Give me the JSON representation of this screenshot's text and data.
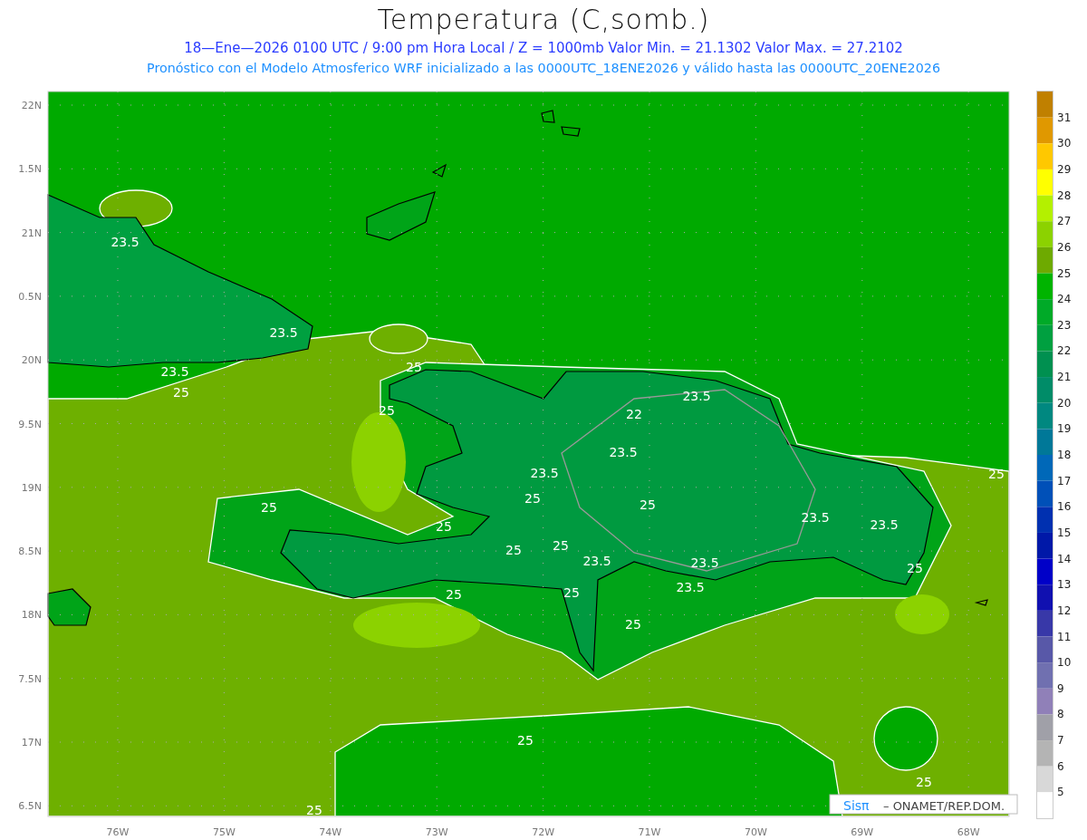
{
  "title": "Temperatura (C,somb.)",
  "subtitle": "18—Ene—2026  0100 UTC / 9:00 pm Hora Local / Z = 1000mb    Valor Min. = 21.1302  Valor Max. = 27.2102",
  "description": "Pronóstico con el Modelo Atmosferico WRF inicializado a las 0000UTC_18ENE2026 y válido hasta las  0000UTC_20ENE2026",
  "map": {
    "lat_labels": [
      "22N",
      "1.5N",
      "21N",
      "0.5N",
      "20N",
      "9.5N",
      "19N",
      "8.5N",
      "18N",
      "7.5N",
      "17N",
      "6.5N"
    ],
    "lon_labels": [
      "76W",
      "75W",
      "74W",
      "73W",
      "72W",
      "71W",
      "70W",
      "69W",
      "68W"
    ],
    "contour_labels": [
      "23.5",
      "23.5",
      "23.5",
      "23.5",
      "23.5",
      "23.5",
      "23.5",
      "23.5",
      "23.5",
      "23.5",
      "23.5",
      "25",
      "25",
      "25",
      "25",
      "25",
      "25",
      "25",
      "25",
      "25",
      "25",
      "25",
      "25",
      "25",
      "25",
      "25",
      "25",
      "25",
      "22"
    ]
  },
  "legend": {
    "steps": [
      {
        "color": "#c08000"
      },
      {
        "color": "#e09800"
      },
      {
        "color": "#ffc800"
      },
      {
        "color": "#ffff00"
      },
      {
        "color": "#b4f000"
      },
      {
        "color": "#8cd200"
      },
      {
        "color": "#6eaa00"
      },
      {
        "color": "#00b400"
      },
      {
        "color": "#00aa28"
      },
      {
        "color": "#00a040"
      },
      {
        "color": "#009050"
      },
      {
        "color": "#008c68"
      },
      {
        "color": "#008880"
      },
      {
        "color": "#007898"
      },
      {
        "color": "#0068b8"
      },
      {
        "color": "#0050b8"
      },
      {
        "color": "#0030b0"
      },
      {
        "color": "#0018a8"
      },
      {
        "color": "#0000c8"
      },
      {
        "color": "#1010b0"
      },
      {
        "color": "#3838a8"
      },
      {
        "color": "#5858a8"
      },
      {
        "color": "#7070b0"
      },
      {
        "color": "#9080b8"
      },
      {
        "color": "#a0a0a8"
      },
      {
        "color": "#b4b4b4"
      },
      {
        "color": "#d8d8d8"
      },
      {
        "color": "#ffffff"
      }
    ],
    "labels": [
      "31",
      "30",
      "29",
      "28",
      "27",
      "26",
      "25",
      "24",
      "23",
      "22",
      "21",
      "20",
      "19",
      "18",
      "17",
      "16",
      "15",
      "14",
      "13",
      "12",
      "11",
      "10",
      "9",
      "8",
      "7",
      "6",
      "5"
    ]
  },
  "credit": {
    "brand": "Sisπ",
    "text": "– ONAMET/REP.DOM."
  }
}
